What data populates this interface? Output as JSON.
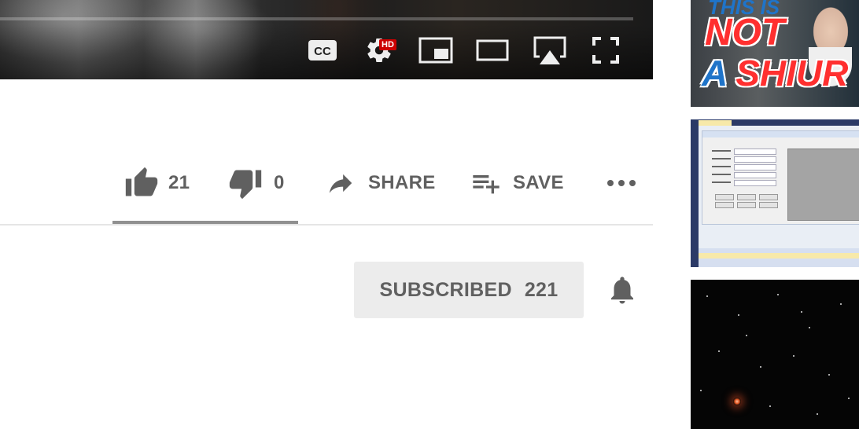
{
  "player": {
    "controls": [
      {
        "name": "subtitles-button",
        "icon": "cc-icon"
      },
      {
        "name": "settings-button",
        "icon": "gear-icon"
      },
      {
        "name": "miniplayer-button",
        "icon": "miniplayer-icon"
      },
      {
        "name": "theater-mode-button",
        "icon": "theater-icon"
      },
      {
        "name": "airplay-button",
        "icon": "airplay-icon"
      },
      {
        "name": "fullscreen-button",
        "icon": "fullscreen-icon"
      }
    ],
    "cc_label": "CC",
    "hd_badge": "HD"
  },
  "actions": {
    "like": {
      "icon": "thumb-up-icon",
      "count": "21"
    },
    "dislike": {
      "icon": "thumb-down-icon",
      "count": "0"
    },
    "share": {
      "icon": "share-arrow-icon",
      "label": "SHARE"
    },
    "save": {
      "icon": "playlist-add-icon",
      "label": "SAVE"
    },
    "more": {
      "icon": "more-horizontal-icon"
    },
    "like_ratio": 1.0
  },
  "channel": {
    "subscribe_label": "SUBSCRIBED",
    "subscriber_count": "221",
    "notification_icon": "bell-icon"
  },
  "sidebar": {
    "thumbnails": [
      {
        "overlay_text": [
          "THIS IS",
          "NOT",
          "A",
          "SHIUR"
        ]
      },
      {},
      {}
    ]
  },
  "colors": {
    "icon_gray": "#606060",
    "subscribed_bg": "#ececec",
    "hd_red": "#cc0000",
    "sentiment_bar": "#909090"
  }
}
